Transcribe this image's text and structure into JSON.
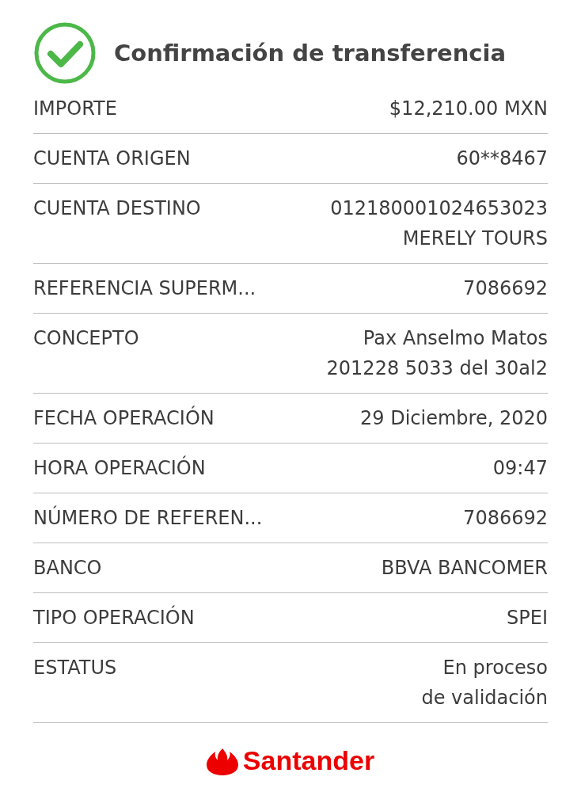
{
  "header": {
    "title": "Confirmación de transferencia"
  },
  "rows": [
    {
      "label": "IMPORTE",
      "value": [
        "$12,210.00 MXN"
      ]
    },
    {
      "label": "CUENTA ORIGEN",
      "value": [
        "60**8467"
      ]
    },
    {
      "label": "CUENTA DESTINO",
      "value": [
        "012180001024653023",
        "MERELY TOURS"
      ]
    },
    {
      "label": "REFERENCIA SUPERM...",
      "value": [
        "7086692"
      ]
    },
    {
      "label": "CONCEPTO",
      "value": [
        "Pax Anselmo Matos",
        "201228 5033 del 30al2"
      ]
    },
    {
      "label": "FECHA OPERACIÓN",
      "value": [
        "29 Diciembre, 2020"
      ]
    },
    {
      "label": "HORA OPERACIÓN",
      "value": [
        "09:47"
      ]
    },
    {
      "label": "NÚMERO DE REFEREN...",
      "value": [
        "7086692"
      ]
    },
    {
      "label": "BANCO",
      "value": [
        "BBVA BANCOMER"
      ]
    },
    {
      "label": "TIPO OPERACIÓN",
      "value": [
        "SPEI"
      ]
    },
    {
      "label": "ESTATUS",
      "value": [
        "En proceso",
        "de validación"
      ]
    }
  ],
  "footer": {
    "brand": "Santander"
  }
}
